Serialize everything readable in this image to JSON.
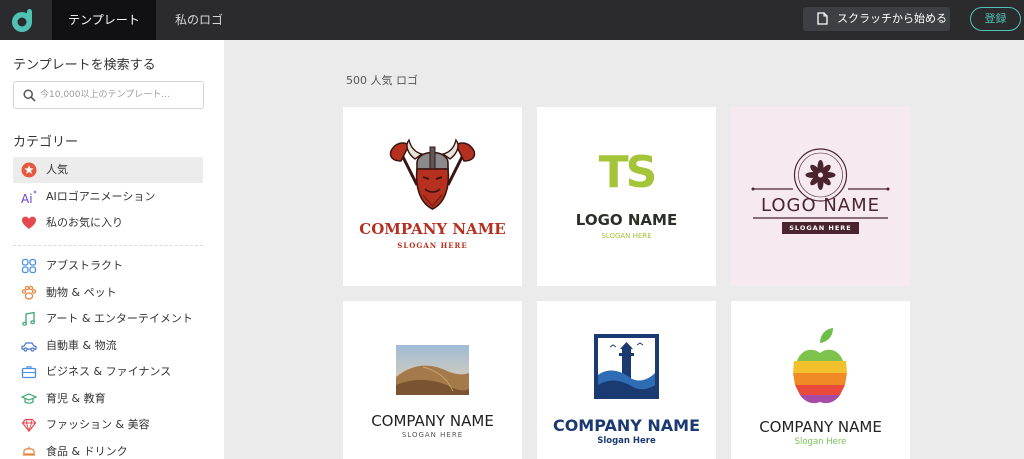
{
  "header": {
    "tabs": [
      {
        "label": "テンプレート",
        "active": true
      },
      {
        "label": "私のロゴ",
        "active": false
      }
    ],
    "scratch_button": "スクラッチから始める",
    "login_button": "登録",
    "accent_color": "#4fc2b4"
  },
  "sidebar": {
    "search_title": "テンプレートを検索する",
    "search_placeholder": "今10,000以上のテンプレート...",
    "search_value": "",
    "category_title": "カテゴリー",
    "top_items": [
      {
        "label": "人気",
        "icon": "star-icon",
        "selected": true
      },
      {
        "label": "AIロゴアニメーション",
        "icon": "ai-icon",
        "selected": false
      },
      {
        "label": "私のお気に入り",
        "icon": "heart-icon",
        "selected": false
      }
    ],
    "categories": [
      {
        "label": "アブストラクト",
        "icon": "abstract-icon"
      },
      {
        "label": "動物 & ペット",
        "icon": "paw-icon"
      },
      {
        "label": "アート & エンターテイメント",
        "icon": "music-note-icon"
      },
      {
        "label": "自動車 & 物流",
        "icon": "car-icon"
      },
      {
        "label": "ビジネス & ファイナンス",
        "icon": "briefcase-icon"
      },
      {
        "label": "育児 & 教育",
        "icon": "graduation-cap-icon"
      },
      {
        "label": "ファッション & 美容",
        "icon": "diamond-icon"
      },
      {
        "label": "食品 & ドリンク",
        "icon": "food-icon"
      }
    ]
  },
  "main": {
    "section_title": "500 人気 ロゴ",
    "cards": [
      {
        "name": "COMPANY NAME",
        "slogan": "SLOGAN HERE",
        "art": "viking-helmet-axes-icon",
        "color": "#b5301f"
      },
      {
        "name": "LOGO NAME",
        "slogan": "SLOGAN HERE",
        "mark": "TS",
        "color": "#a4c43a"
      },
      {
        "name": "LOGO NAME",
        "slogan": "SLOGAN HERE",
        "art": "ornamental-flower-icon",
        "color": "#4a2530"
      },
      {
        "name": "COMPANY NAME",
        "slogan": "SLOGAN HERE",
        "art": "desert-dunes-icon",
        "color": "#222222"
      },
      {
        "name": "COMPANY NAME",
        "slogan": "Slogan Here",
        "art": "lighthouse-waves-icon",
        "color": "#1c3a72"
      },
      {
        "name": "COMPANY NAME",
        "slogan": "Slogan Here",
        "art": "rainbow-apple-icon",
        "color": "#78c257"
      }
    ]
  }
}
